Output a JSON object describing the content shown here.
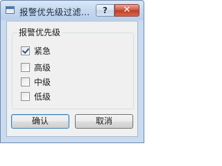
{
  "window": {
    "title": "报警优先级过滤...",
    "help_label": "?",
    "close_label": "✕"
  },
  "group": {
    "label": "报警优先级",
    "items": [
      {
        "label": "紧急",
        "checked": true
      },
      {
        "label": "高级",
        "checked": false
      },
      {
        "label": "中级",
        "checked": false
      },
      {
        "label": "低级",
        "checked": false
      }
    ]
  },
  "buttons": {
    "ok_label": "确认",
    "cancel_label": "取消"
  }
}
